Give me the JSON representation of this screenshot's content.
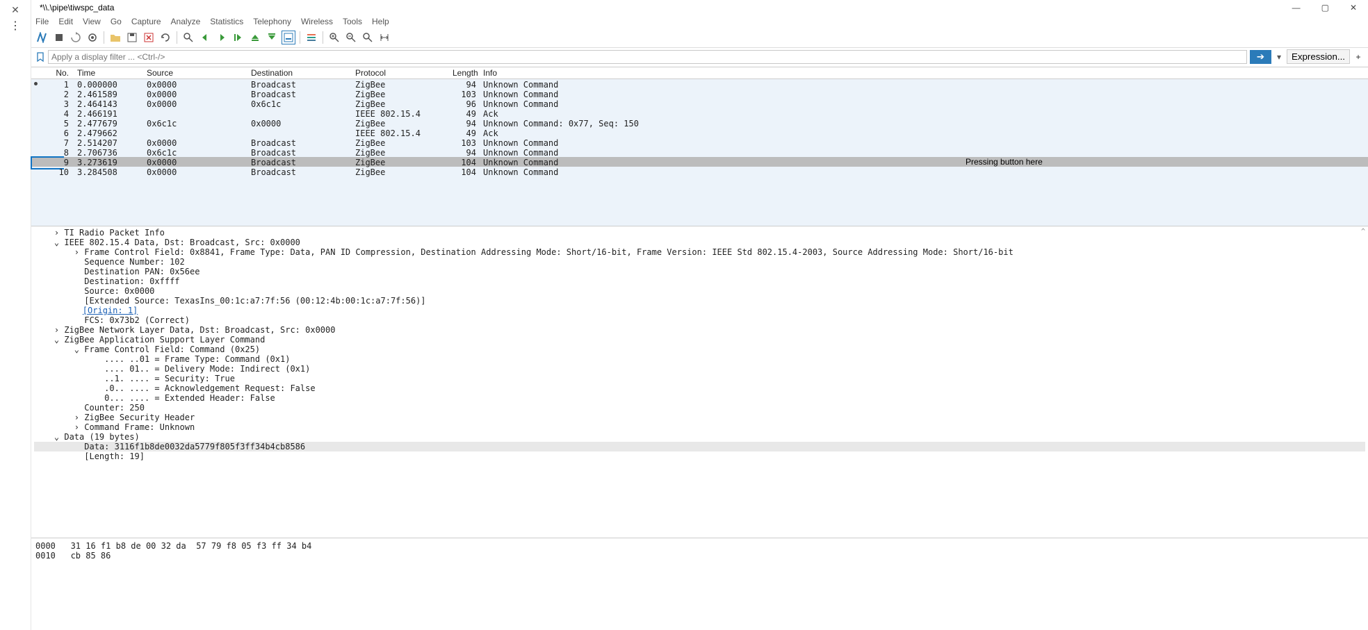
{
  "window": {
    "title": "*\\\\.\\pipe\\tiwspc_data"
  },
  "menu": [
    "File",
    "Edit",
    "View",
    "Go",
    "Capture",
    "Analyze",
    "Statistics",
    "Telephony",
    "Wireless",
    "Tools",
    "Help"
  ],
  "filter": {
    "placeholder": "Apply a display filter ... <Ctrl-/>",
    "apply": "➔",
    "expression": "Expression...",
    "plus": "+"
  },
  "columns": {
    "no": "No.",
    "time": "Time",
    "src": "Source",
    "dst": "Destination",
    "proto": "Protocol",
    "len": "Length",
    "info": "Info"
  },
  "packets": [
    {
      "no": 1,
      "time": "0.000000",
      "src": "0x0000",
      "dst": "Broadcast",
      "proto": "ZigBee",
      "len": 94,
      "info": "Unknown Command",
      "marker": true
    },
    {
      "no": 2,
      "time": "2.461589",
      "src": "0x0000",
      "dst": "Broadcast",
      "proto": "ZigBee",
      "len": 103,
      "info": "Unknown Command"
    },
    {
      "no": 3,
      "time": "2.464143",
      "src": "0x0000",
      "dst": "0x6c1c",
      "proto": "ZigBee",
      "len": 96,
      "info": "Unknown Command"
    },
    {
      "no": 4,
      "time": "2.466191",
      "src": "",
      "dst": "",
      "proto": "IEEE 802.15.4",
      "len": 49,
      "info": "Ack"
    },
    {
      "no": 5,
      "time": "2.477679",
      "src": "0x6c1c",
      "dst": "0x0000",
      "proto": "ZigBee",
      "len": 94,
      "info": "Unknown Command: 0x77, Seq: 150"
    },
    {
      "no": 6,
      "time": "2.479662",
      "src": "",
      "dst": "",
      "proto": "IEEE 802.15.4",
      "len": 49,
      "info": "Ack"
    },
    {
      "no": 7,
      "time": "2.514207",
      "src": "0x0000",
      "dst": "Broadcast",
      "proto": "ZigBee",
      "len": 103,
      "info": "Unknown Command"
    },
    {
      "no": 8,
      "time": "2.706736",
      "src": "0x6c1c",
      "dst": "Broadcast",
      "proto": "ZigBee",
      "len": 94,
      "info": "Unknown Command"
    },
    {
      "no": 9,
      "time": "3.273619",
      "src": "0x0000",
      "dst": "Broadcast",
      "proto": "ZigBee",
      "len": 104,
      "info": "Unknown Command",
      "selected": true,
      "annot": "Pressing button here"
    },
    {
      "no": 10,
      "time": "3.284508",
      "src": "0x0000",
      "dst": "Broadcast",
      "proto": "ZigBee",
      "len": 104,
      "info": "Unknown Command"
    }
  ],
  "details": [
    {
      "i": 0,
      "c": ">",
      "t": "TI Radio Packet Info"
    },
    {
      "i": 0,
      "c": "v",
      "t": "IEEE 802.15.4 Data, Dst: Broadcast, Src: 0x0000"
    },
    {
      "i": 1,
      "c": ">",
      "t": "Frame Control Field: 0x8841, Frame Type: Data, PAN ID Compression, Destination Addressing Mode: Short/16-bit, Frame Version: IEEE Std 802.15.4-2003, Source Addressing Mode: Short/16-bit"
    },
    {
      "i": 1,
      "c": " ",
      "t": "Sequence Number: 102"
    },
    {
      "i": 1,
      "c": " ",
      "t": "Destination PAN: 0x56ee"
    },
    {
      "i": 1,
      "c": " ",
      "t": "Destination: 0xffff"
    },
    {
      "i": 1,
      "c": " ",
      "t": "Source: 0x0000"
    },
    {
      "i": 1,
      "c": " ",
      "t": "[Extended Source: TexasIns_00:1c:a7:7f:56 (00:12:4b:00:1c:a7:7f:56)]"
    },
    {
      "i": 1,
      "c": " ",
      "t": "[Origin: 1]",
      "link": true
    },
    {
      "i": 1,
      "c": " ",
      "t": "FCS: 0x73b2 (Correct)"
    },
    {
      "i": 0,
      "c": ">",
      "t": "ZigBee Network Layer Data, Dst: Broadcast, Src: 0x0000"
    },
    {
      "i": 0,
      "c": "v",
      "t": "ZigBee Application Support Layer Command"
    },
    {
      "i": 1,
      "c": "v",
      "t": "Frame Control Field: Command (0x25)"
    },
    {
      "i": 2,
      "c": " ",
      "t": ".... ..01 = Frame Type: Command (0x1)"
    },
    {
      "i": 2,
      "c": " ",
      "t": ".... 01.. = Delivery Mode: Indirect (0x1)"
    },
    {
      "i": 2,
      "c": " ",
      "t": "..1. .... = Security: True"
    },
    {
      "i": 2,
      "c": " ",
      "t": ".0.. .... = Acknowledgement Request: False"
    },
    {
      "i": 2,
      "c": " ",
      "t": "0... .... = Extended Header: False"
    },
    {
      "i": 1,
      "c": " ",
      "t": "Counter: 250"
    },
    {
      "i": 1,
      "c": ">",
      "t": "ZigBee Security Header"
    },
    {
      "i": 1,
      "c": ">",
      "t": "Command Frame: Unknown"
    },
    {
      "i": 0,
      "c": "v",
      "t": "Data (19 bytes)"
    },
    {
      "i": 1,
      "c": " ",
      "t": "Data: 3116f1b8de0032da5779f805f3ff34b4cb8586",
      "hl": true
    },
    {
      "i": 1,
      "c": " ",
      "t": "[Length: 19]"
    }
  ],
  "hex": [
    {
      "off": "0000",
      "b": "31 16 f1 b8 de 00 32 da  57 79 f8 05 f3 ff 34 b4"
    },
    {
      "off": "0010",
      "b": "cb 85 86"
    }
  ]
}
